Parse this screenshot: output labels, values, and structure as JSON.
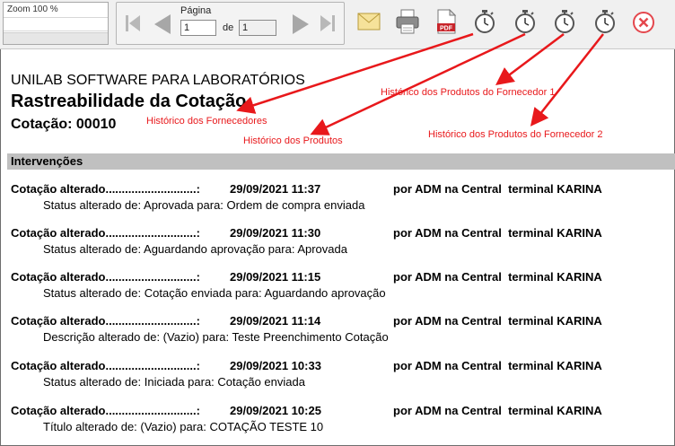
{
  "toolbar": {
    "zoom_label": "Zoom 100 %",
    "page_label": "Página",
    "page_value": "1",
    "of_label": "de",
    "total_pages": "1",
    "icons": [
      "first-page-icon",
      "previous-page-icon",
      "next-page-icon",
      "last-page-icon",
      "email-icon",
      "printer-icon",
      "pdf-icon",
      "stopwatch-icon",
      "stopwatch-icon",
      "stopwatch-icon",
      "stopwatch-icon",
      "close-icon"
    ],
    "pdf_badge": "PDF",
    "accent_close": "#e4474d"
  },
  "report": {
    "company": "UNILAB SOFTWARE PARA LABORATÓRIOS",
    "title": "Rastreabilidade da Cotação",
    "quote_number": "Cotação: 00010",
    "section_title": "Intervenções",
    "entries": [
      {
        "label": "Cotação alterado............................:",
        "datetime": "29/09/2021 11:37",
        "by": "por ADM na Central  terminal KARINA",
        "description": "Status alterado de: Aprovada para: Ordem de compra enviada"
      },
      {
        "label": "Cotação alterado............................:",
        "datetime": "29/09/2021 11:30",
        "by": "por ADM na Central  terminal KARINA",
        "description": "Status alterado de: Aguardando aprovação para: Aprovada"
      },
      {
        "label": "Cotação alterado............................:",
        "datetime": "29/09/2021 11:15",
        "by": "por ADM na Central  terminal KARINA",
        "description": "Status alterado de: Cotação enviada para: Aguardando aprovação"
      },
      {
        "label": "Cotação alterado............................:",
        "datetime": "29/09/2021 11:14",
        "by": "por ADM na Central  terminal KARINA",
        "description": "Descrição alterado de: (Vazio) para: Teste Preenchimento Cotação"
      },
      {
        "label": "Cotação alterado............................:",
        "datetime": "29/09/2021 10:33",
        "by": "por ADM na Central  terminal KARINA",
        "description": "Status alterado de: Iniciada para: Cotação enviada"
      },
      {
        "label": "Cotação alterado............................:",
        "datetime": "29/09/2021 10:25",
        "by": "por ADM na Central  terminal KARINA",
        "description": "Título alterado de: (Vazio) para: COTAÇÃO TESTE 10"
      }
    ]
  },
  "annotations": {
    "color": "#e8181b",
    "fornecedores": "Histórico dos Fornecedores",
    "produtos": "Histórico dos Produtos",
    "produtos_fornecedor_1": "Histórico dos Produtos do Fornecedor 1",
    "produtos_fornecedor_2": "Histórico dos Produtos do Fornecedor 2"
  }
}
